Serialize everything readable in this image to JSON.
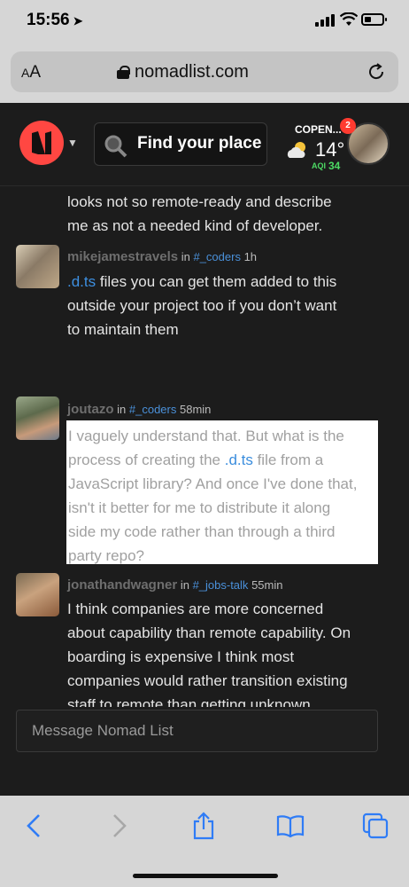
{
  "status_bar": {
    "time": "15:56"
  },
  "browser": {
    "text_size_label": "AA",
    "url": "nomadlist.com"
  },
  "header": {
    "search_placeholder": "Find your place",
    "weather": {
      "city": "COPEN...",
      "temp": "14°",
      "aqi_label": "AQI",
      "aqi_value": "34"
    },
    "notification_count": "2"
  },
  "feed": {
    "continuation_lines": [
      "looks not so remote-ready and describe",
      "me as not a needed kind of developer."
    ],
    "messages": [
      {
        "user": "mikejamestravels",
        "in": "in",
        "channel": "#_coders",
        "time": "1h",
        "lines": [
          {
            "code": ".d.ts",
            "text": " files you can get them added to this"
          },
          {
            "text": "outside your project too if you don’t want"
          },
          {
            "text": "to maintain them"
          }
        ]
      },
      {
        "user": "joutazo",
        "in": "in",
        "channel": "#_coders",
        "time": "58min",
        "lines": [
          {
            "text": "I vaguely understand that. But what is the"
          },
          {
            "pre": "process of creating the ",
            "code": ".d.ts",
            "text": " file from a"
          },
          {
            "text": "JavaScript library? And once I've done that,"
          },
          {
            "text": "isn't it better for me to distribute it along"
          },
          {
            "text": "side my code rather than through a third"
          },
          {
            "text": "party repo?"
          }
        ]
      },
      {
        "user": "jonathandwagner",
        "in": "in",
        "channel": "#_jobs-talk",
        "time": "55min",
        "lines": [
          {
            "text": "I think companies are more concerned"
          },
          {
            "text": "about capability than remote capability. On"
          },
          {
            "text": "boarding is expensive I think most"
          },
          {
            "text": "companies would rather transition existing"
          },
          {
            "text": "staff to remote than getting unknown"
          }
        ]
      }
    ]
  },
  "composer": {
    "placeholder": "Message Nomad List"
  },
  "colors": {
    "brand": "#ff4742",
    "link": "#4a90d9",
    "aqi": "#4cd964",
    "background": "#1c1c1c"
  }
}
